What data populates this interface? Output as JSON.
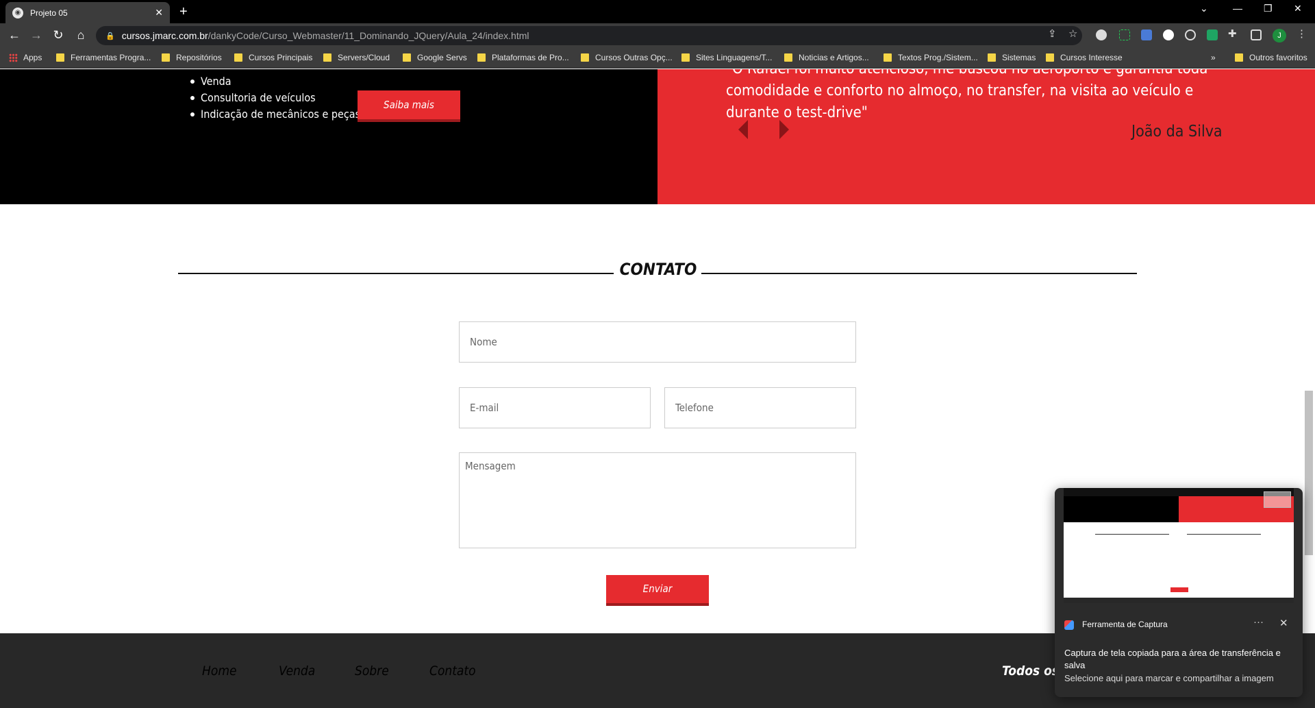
{
  "browser": {
    "tab_title": "Projeto 05",
    "url_host": "cursos.jmarc.com.br",
    "url_path": "/dankyCode/Curso_Webmaster/11_Dominando_JQuery/Aula_24/index.html",
    "profile_initial": "J"
  },
  "bookmarks": {
    "apps": "Apps",
    "items": [
      "Ferramentas Progra...",
      "Repositórios",
      "Cursos Principais",
      "Servers/Cloud",
      "Google Servs",
      "Plataformas de Pro...",
      "Cursos Outras Opç...",
      "Sites Linguagens/T...",
      "Noticias e Artigos...",
      "Textos Prog./Sistem...",
      "Sistemas",
      "Cursos Interesse"
    ],
    "overflow": "»",
    "other": "Outros favoritos"
  },
  "services": {
    "items": [
      "Venda",
      "Consultoria de veículos",
      "Indicação de mecânicos e peças"
    ],
    "button": "Saiba mais"
  },
  "testimonial": {
    "quote": "\"O Rafael foi muito atencioso, me buscou no aeroporto e garantiu toda comodidade e conforto no almoço, no transfer, na visita ao veículo e durante o test-drive\"",
    "author": "João da Silva"
  },
  "contact": {
    "title": "CONTATO",
    "name_placeholder": "Nome",
    "email_placeholder": "E-mail",
    "phone_placeholder": "Telefone",
    "message_placeholder": "Mensagem",
    "submit": "Enviar"
  },
  "footer": {
    "links": [
      "Home",
      "Venda",
      "Sobre",
      "Contato"
    ],
    "copyright": "Todos os di"
  },
  "toast": {
    "app_name": "Ferramenta de Captura",
    "more": "···",
    "message": "Captura de tela copiada para a área de transferência e salva",
    "hint": "Selecione aqui para marcar e compartilhar a imagem"
  },
  "colors": {
    "accent_red": "#e62b2f",
    "footer_bg": "#282828"
  }
}
